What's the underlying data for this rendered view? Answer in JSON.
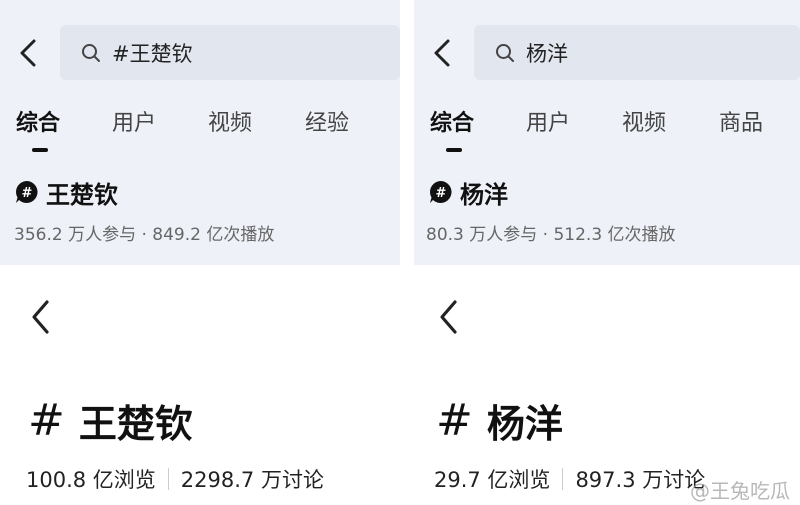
{
  "left": {
    "search_query": "#王楚钦",
    "tabs": [
      "综合",
      "用户",
      "视频",
      "经验"
    ],
    "topic_name": "王楚钦",
    "topic_stats": "356.2 万人参与 · 849.2 亿次播放",
    "big_hash": "#",
    "big_name": "王楚钦",
    "views": "100.8 亿浏览",
    "discussions": "2298.7 万讨论"
  },
  "right": {
    "search_query": "杨洋",
    "tabs": [
      "综合",
      "用户",
      "视频",
      "商品"
    ],
    "topic_name": "杨洋",
    "topic_stats": "80.3 万人参与 · 512.3 亿次播放",
    "big_hash": "#",
    "big_name": "杨洋",
    "views": "29.7 亿浏览",
    "discussions": "897.3 万讨论"
  },
  "watermark": "@王兔吃瓜",
  "icons": {
    "back": "chevron-left-icon",
    "search": "search-icon",
    "topic": "hashtag-bubble-icon"
  }
}
